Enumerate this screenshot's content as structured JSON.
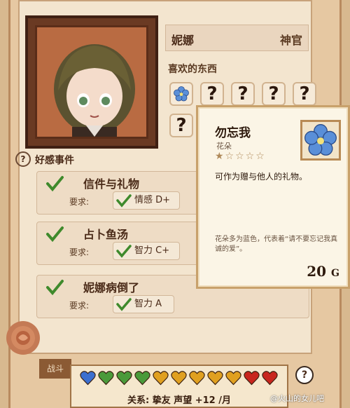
{
  "character": {
    "name": "妮娜",
    "class": "神官"
  },
  "likes": {
    "title": "喜欢的东西",
    "slots": [
      "forget-me-not-flower",
      "?",
      "?",
      "?",
      "?",
      "?"
    ]
  },
  "favor_events": {
    "title": "好感事件",
    "help": "?",
    "events": [
      {
        "title": "信件与礼物",
        "req_label": "要求:",
        "req": "情感 D+"
      },
      {
        "title": "占卜鱼汤",
        "req_label": "要求:",
        "req": "智力 C+"
      },
      {
        "title": "妮娜病倒了",
        "req_label": "要求:",
        "req": "智力 A"
      }
    ]
  },
  "tooltip": {
    "name": "勿忘我",
    "category": "花朵",
    "stars": "★☆☆☆☆",
    "rating": 1,
    "description": "可作为赠与他人的礼物。",
    "flavor": "花朵多为蓝色，代表着“请不要忘记我真诚的爱”。",
    "price": "20",
    "currency": "G"
  },
  "bottom": {
    "tab": "战斗",
    "hearts": [
      "#3b6fcf",
      "#4a9a3a",
      "#4a9a3a",
      "#4a9a3a",
      "#e0a020",
      "#e0a020",
      "#e0a020",
      "#e0a020",
      "#e0a020",
      "#c8261e",
      "#c8261e"
    ],
    "relation": "关系: 挚友    声望 +12 /月",
    "help": "?"
  },
  "watermark": "@火山的女儿吧"
}
